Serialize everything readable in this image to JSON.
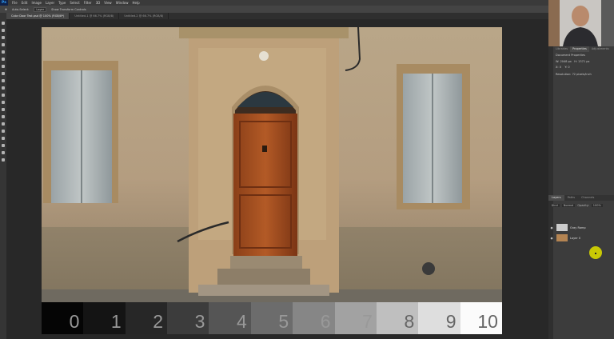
{
  "menubar": {
    "logo": "Ps",
    "items": [
      "File",
      "Edit",
      "Image",
      "Layer",
      "Type",
      "Select",
      "Filter",
      "3D",
      "View",
      "Window",
      "Help"
    ]
  },
  "options_bar": {
    "mode_label": "Auto-Select:",
    "mode_value": "Layer",
    "transform_label": "Show Transform Controls"
  },
  "tabs": [
    {
      "label": "Color Door Test.psd @ 100% (RGB/8*)",
      "active": true
    },
    {
      "label": "Untitled-1 @ 66.7% (RGB/8)",
      "active": false
    },
    {
      "label": "Untitled-2 @ 66.7% (RGB/8)",
      "active": false
    }
  ],
  "properties": {
    "tabs": [
      "Libraries",
      "Properties",
      "Adjustments"
    ],
    "active_tab": 1,
    "header": "Document Properties",
    "w_label": "W:",
    "w_value": "2048 px",
    "h_label": "H:",
    "h_value": "1371 px",
    "x_label": "X:",
    "x_value": "0",
    "y_label": "Y:",
    "y_value": "0",
    "resolution": "Resolution: 72 pixels/inch"
  },
  "layers_panel": {
    "tabs": [
      "Layers",
      "Paths",
      "Channels"
    ],
    "active_tab": 0,
    "filter_label": "Kind",
    "blend_label": "Normal",
    "opacity_label": "Opacity:",
    "opacity_value": "100%",
    "layers": [
      {
        "name": "Gray Ramp",
        "thumb": "#cccccc"
      },
      {
        "name": "Layer 0",
        "thumb": "#b48452"
      }
    ]
  },
  "grayscale_strip": {
    "labels": [
      "0",
      "1",
      "2",
      "3",
      "4",
      "5",
      "6",
      "7",
      "8",
      "9",
      "10"
    ],
    "colors": [
      "#050505",
      "#141414",
      "#272727",
      "#3c3c3c",
      "#555555",
      "#6c6c6c",
      "#868686",
      "#a2a2a2",
      "#bfbfbf",
      "#dedede",
      "#fbfbfb"
    ]
  },
  "icons": {
    "toolbar": [
      "move-tool",
      "marquee-tool",
      "lasso-tool",
      "quick-select-tool",
      "crop-tool",
      "eyedropper-tool",
      "healing-brush-tool",
      "brush-tool",
      "clone-stamp-tool",
      "history-brush-tool",
      "eraser-tool",
      "gradient-tool",
      "blur-tool",
      "dodge-tool",
      "pen-tool",
      "type-tool",
      "path-select-tool",
      "shape-tool",
      "hand-tool",
      "zoom-tool"
    ]
  }
}
